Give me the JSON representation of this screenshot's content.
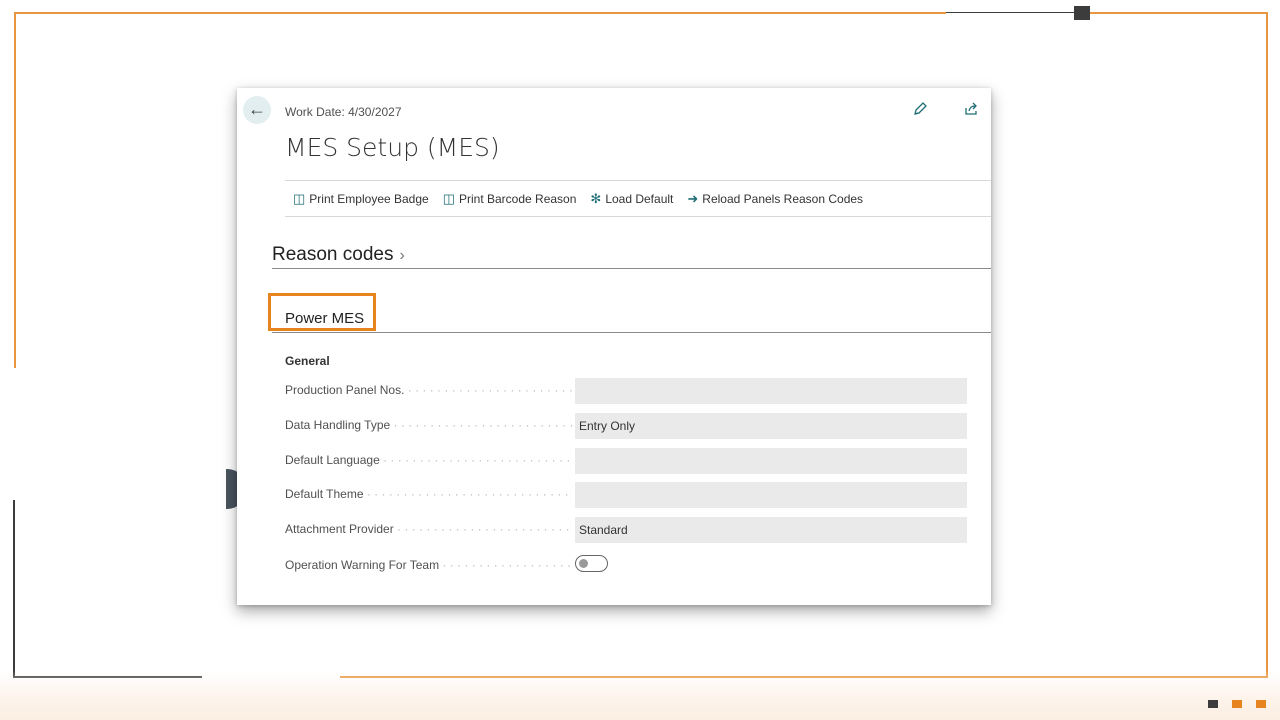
{
  "window": {
    "work_date": "Work Date: 4/30/2027",
    "title": "MES Setup (MES)",
    "back_icon": "arrow-left-icon",
    "edit_icon": "pencil-icon",
    "share_icon": "share-icon"
  },
  "actions": [
    {
      "label": "Print Employee Badge",
      "icon": "print-badge-icon"
    },
    {
      "label": "Print Barcode Reason",
      "icon": "print-barcode-icon"
    },
    {
      "label": "Load Default",
      "icon": "gears-icon"
    },
    {
      "label": "Reload Panels Reason Codes",
      "icon": "reload-arrow-icon"
    }
  ],
  "sections": {
    "reason_codes": "Reason codes",
    "power_mes": "Power MES",
    "general": "General"
  },
  "fields": [
    {
      "label": "Production Panel Nos.",
      "value": ""
    },
    {
      "label": "Data Handling Type",
      "value": "Entry Only"
    },
    {
      "label": "Default Language",
      "value": ""
    },
    {
      "label": "Default Theme",
      "value": ""
    },
    {
      "label": "Attachment Provider",
      "value": "Standard"
    },
    {
      "label": "Operation Warning For Team",
      "toggle": false
    }
  ],
  "colors": {
    "accent_orange": "#e8841f",
    "teal_icon": "#1f6e75",
    "dark_line": "#3c3c3c"
  }
}
